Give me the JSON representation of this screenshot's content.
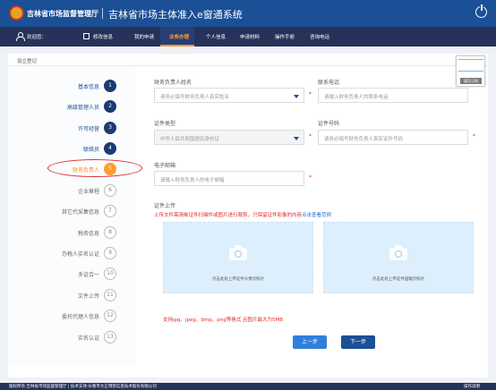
{
  "header": {
    "org_name": "吉林省市场监督管理厅",
    "app_title": "吉林省市场主体准入e窗通系统"
  },
  "nav": {
    "welcome": "欢迎您：",
    "user_name": "",
    "edit_info": "修改信息",
    "items": [
      "我的申请",
      "业务办理",
      "个人信息",
      "申请材料",
      "操作手册",
      "咨询电话"
    ],
    "active": "业务办理"
  },
  "breadcrumb": "设立登记",
  "sample_label": "填写示例",
  "steps": [
    {
      "num": "1",
      "label": "基本信息",
      "state": "done"
    },
    {
      "num": "2",
      "label": "高级管理人员",
      "state": "done"
    },
    {
      "num": "3",
      "label": "许可经营",
      "state": "done"
    },
    {
      "num": "4",
      "label": "联络员",
      "state": "done"
    },
    {
      "num": "5",
      "label": "财务负责人",
      "state": "current"
    },
    {
      "num": "6",
      "label": "企业章程",
      "state": "todo"
    },
    {
      "num": "7",
      "label": "其它代采集信息",
      "state": "todo"
    },
    {
      "num": "8",
      "label": "税务信息",
      "state": "todo"
    },
    {
      "num": "9",
      "label": "办税人实名认证",
      "state": "todo"
    },
    {
      "num": "10",
      "label": "多证合一",
      "state": "todo"
    },
    {
      "num": "11",
      "label": "文件上传",
      "state": "todo"
    },
    {
      "num": "12",
      "label": "委托代理人信息",
      "state": "todo"
    },
    {
      "num": "13",
      "label": "实名认证",
      "state": "todo"
    }
  ],
  "form": {
    "name_label": "财务负责人姓名",
    "name_placeholder": "请务必填写财务负责人真实姓名",
    "phone_label": "联系电话",
    "phone_placeholder": "请输入财务负责人的联系电话",
    "idtype_label": "证件类型",
    "idtype_value": "中华人民共和国居民身份证",
    "idnum_label": "证件号码",
    "idnum_placeholder": "请务必填写财务负责人真实证件号码",
    "email_label": "电子邮箱",
    "email_placeholder": "请输入财务负责人的电子邮箱",
    "upload_label": "证件上传",
    "upload_note": "上传文件需清晰证件扫描件或图片进行裁剪，只保留证件影像的内容",
    "upload_note_link": "点击查看范例",
    "upload_front": "点击此处上传证件头像页照片",
    "upload_back": "点击此处上传证件国徽页照片",
    "format_note": "支持jpg、jpeg、bmp、png等格式 且图片最大为5MB",
    "prev_button": "上一步",
    "next_button": "下一步",
    "required_mark": "*"
  },
  "footer": {
    "copyright": "版权所有:吉林省市场监督管理厅 | 技术支持:长春市大正博凯信息技术股份有限公司",
    "right_text": "操作说明"
  }
}
